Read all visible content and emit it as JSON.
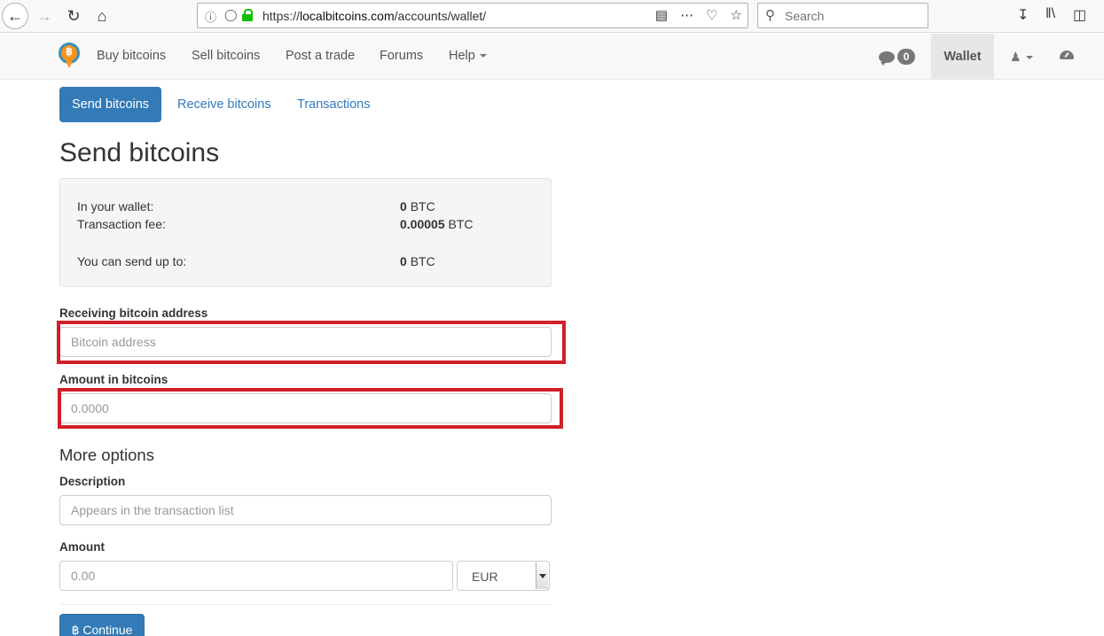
{
  "browser": {
    "url_prefix": "https://",
    "url_host": "localbitcoins.com",
    "url_path": "/accounts/wallet/",
    "search_placeholder": "Search"
  },
  "navbar": {
    "links": [
      "Buy bitcoins",
      "Sell bitcoins",
      "Post a trade",
      "Forums",
      "Help"
    ],
    "messages_count": "0",
    "wallet_label": "Wallet"
  },
  "tabs": [
    "Send bitcoins",
    "Receive bitcoins",
    "Transactions"
  ],
  "page_title": "Send bitcoins",
  "summary": {
    "wallet_label": "In your wallet:",
    "wallet_amount": "0",
    "wallet_unit": "BTC",
    "fee_label": "Transaction fee:",
    "fee_amount": "0.00005",
    "fee_unit": "BTC",
    "send_label": "You can send up to:",
    "send_amount": "0",
    "send_unit": "BTC"
  },
  "form": {
    "address_label": "Receiving bitcoin address",
    "address_placeholder": "Bitcoin address",
    "amount_btc_label": "Amount in bitcoins",
    "amount_btc_placeholder": "0.0000",
    "more_options": "More options",
    "description_label": "Description",
    "description_placeholder": "Appears in the transaction list",
    "amount_label": "Amount",
    "amount_placeholder": "0.00",
    "currency": "EUR",
    "continue_label": "Continue",
    "continue_icon": "฿"
  },
  "colors": {
    "primary": "#337ab7",
    "highlight": "#d0202a",
    "secure": "#12bc00"
  }
}
